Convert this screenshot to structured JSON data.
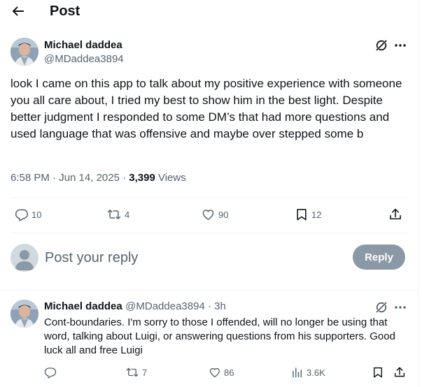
{
  "header": {
    "title": "Post"
  },
  "post": {
    "author_name": "Michael daddea",
    "author_handle": "@MDaddea3894",
    "text": "look I came on this app to talk about my positive experience with someone you all care about, I tried my best to show him in the best light. Despite better judgment I responded to some DM’s that had more questions and used language that was offensive and maybe over stepped some b",
    "time": "6:58 PM · Jun 14, 2025 · ",
    "views_count": "3,399",
    "views_label": " Views",
    "replies": "10",
    "reposts": "4",
    "likes": "90",
    "bookmarks": "12"
  },
  "compose": {
    "placeholder": "Post your reply",
    "button_label": "Reply"
  },
  "reply": {
    "author_name": "Michael daddea",
    "author_handle": "@MDaddea3894 · 3h",
    "text": "Cont-boundaries. I'm sorry to those I offended, will no longer be using that word, talking about Luigi, or answering questions from his supporters. Good luck all and free Luigi",
    "replies": "",
    "reposts": "7",
    "likes": "86",
    "views": "3.6K"
  },
  "colors": {
    "text": "#0f1419",
    "secondary": "#536471",
    "reply_button": "#8b98a5",
    "divider": "#eff3f4"
  },
  "icons": [
    "back-arrow-icon",
    "grok-icon",
    "more-icon",
    "reply-icon",
    "repost-icon",
    "like-icon",
    "bookmark-icon",
    "share-icon",
    "views-icon"
  ]
}
